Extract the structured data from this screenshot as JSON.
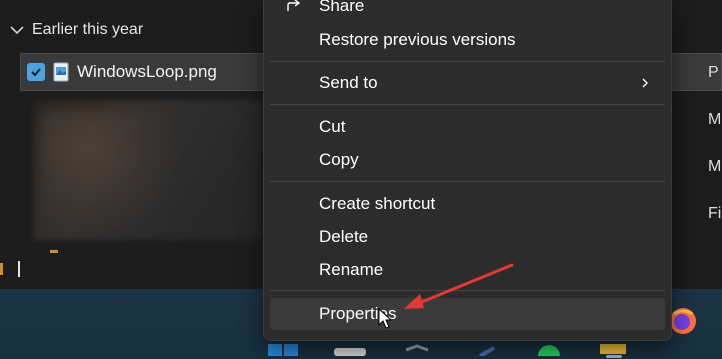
{
  "explorer": {
    "group_label": "Earlier this year",
    "selected_file": "WindowsLoop.png",
    "right_column": [
      "P",
      "M",
      "M",
      "Fi"
    ]
  },
  "context_menu": {
    "items": [
      {
        "label": "Share",
        "icon": "share-icon"
      },
      {
        "label": "Restore previous versions"
      },
      {
        "label": "Send to",
        "submenu": true
      },
      {
        "label": "Cut"
      },
      {
        "label": "Copy"
      },
      {
        "label": "Create shortcut"
      },
      {
        "label": "Delete"
      },
      {
        "label": "Rename"
      },
      {
        "label": "Properties",
        "hovered": true
      }
    ]
  },
  "annotation": {
    "arrow_color": "#e53935"
  },
  "colors": {
    "menu_bg": "#2c2c2c",
    "hover_bg": "#3b3b3b",
    "checkbox_accent": "#4aa3df",
    "taskbar_bg": "#1c3344"
  }
}
